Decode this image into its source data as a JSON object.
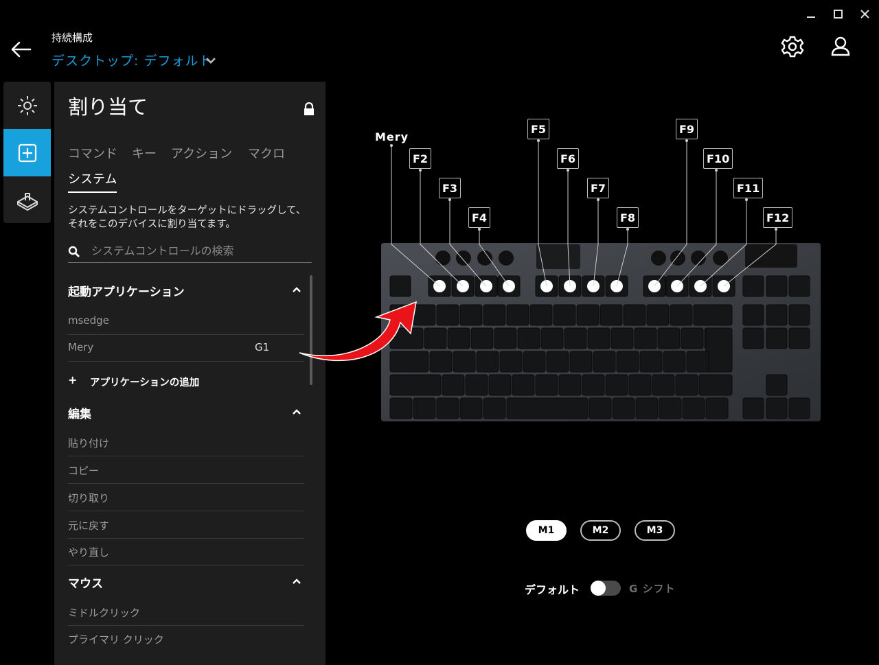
{
  "header": {
    "title": "持続構成",
    "profile_name": "デスクトップ: デフォルト",
    "accent_color": "#1c9bd8"
  },
  "window_controls": [
    "minimize-icon",
    "maximize-icon",
    "close-icon"
  ],
  "top_right": [
    "gear-icon",
    "user-icon"
  ],
  "rail": {
    "items": [
      {
        "icon": "lighting-icon",
        "active": false
      },
      {
        "icon": "assignment-plus-icon",
        "active": true
      },
      {
        "icon": "gaming-mode-icon",
        "active": false
      }
    ]
  },
  "panel": {
    "title": "割り当て",
    "tabs": [
      "コマンド",
      "キー",
      "アクション",
      "マクロ",
      "システム"
    ],
    "selected_tab": "システム",
    "description": "システムコントロールをターゲットにドラッグして、それをこのデバイスに割り当てます。",
    "search_placeholder": "システムコントロールの検索",
    "sections": {
      "launch": {
        "title": "起動アプリケーション",
        "items": [
          {
            "label": "msedge",
            "key": ""
          },
          {
            "label": "Mery",
            "key": "G1"
          }
        ],
        "add_label": "アプリケーションの追加"
      },
      "edit": {
        "title": "編集",
        "items": [
          "貼り付け",
          "コピー",
          "切り取り",
          "元に戻す",
          "やり直し"
        ]
      },
      "mouse": {
        "title": "マウス",
        "items": [
          "ミドルクリック",
          "プライマリ クリック"
        ]
      }
    }
  },
  "keyboard": {
    "assigned_label": "Mery",
    "callouts": [
      "F2",
      "F3",
      "F4",
      "F5",
      "F6",
      "F7",
      "F8",
      "F9",
      "F10",
      "F11",
      "F12"
    ],
    "arrow_color": "#e8141a"
  },
  "memory_buttons": [
    {
      "label": "M1",
      "active": true
    },
    {
      "label": "M2",
      "active": false
    },
    {
      "label": "M3",
      "active": false
    }
  ],
  "mode": {
    "default_label": "デフォルト",
    "gshift_label": "G シフト"
  }
}
